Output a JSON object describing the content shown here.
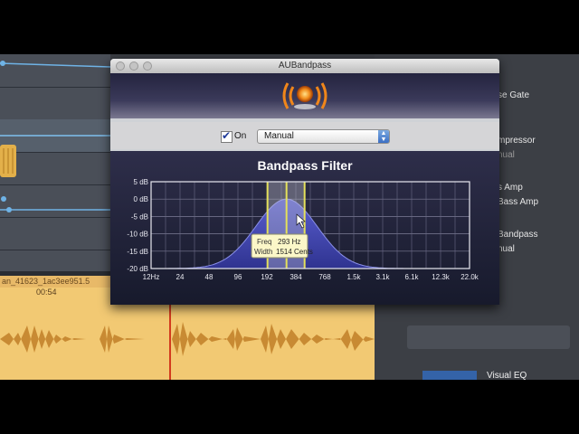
{
  "background": {
    "region_name": "an_41623_1ac3ee951.5",
    "region_time": "00:54",
    "right_panel_items": [
      {
        "label": "se Gate",
        "dim": false
      },
      {
        "label": "mpressor",
        "dim": false
      },
      {
        "label": "nual",
        "dim": true
      },
      {
        "label": "s Amp",
        "dim": false
      },
      {
        "label": "Bass Amp",
        "dim": false
      },
      {
        "label": "Bandpass",
        "dim": false
      },
      {
        "label": "nual",
        "dim": false
      }
    ],
    "visual_eq_label": "Visual EQ"
  },
  "plugin": {
    "window_title": "AUBandpass",
    "on_label": "On",
    "on_checked": true,
    "mode_value": "Manual",
    "graph_title": "Bandpass Filter",
    "y_labels": [
      "5 dB",
      "0 dB",
      "-5 dB",
      "-10 dB",
      "-15 dB",
      "-20 dB"
    ],
    "x_labels": [
      "12Hz",
      "24",
      "48",
      "96",
      "192",
      "384",
      "768",
      "1.5k",
      "3.1k",
      "6.1k",
      "12.3k",
      "22.0k"
    ],
    "tooltip": {
      "freq_label": "Freq",
      "freq_value": "293 Hz",
      "width_label": "Width",
      "width_value": "1514 Cents"
    },
    "colors": {
      "curve_fill": "#4f55c8",
      "band_marker": "#e4e05a",
      "grid": "#8a8aa0"
    }
  }
}
